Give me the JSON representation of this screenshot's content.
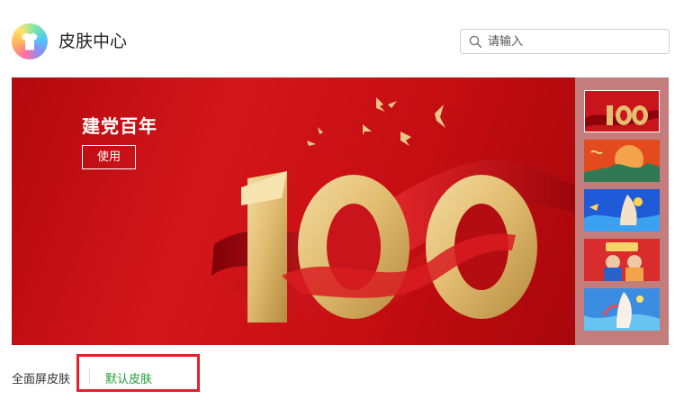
{
  "header": {
    "title": "皮肤中心",
    "search_placeholder": "请输入"
  },
  "featured": {
    "title": "建党百年",
    "use_label": "使用",
    "artwork_number": "100"
  },
  "thumbnails": [
    {
      "name": "100",
      "selected": true
    },
    {
      "name": "theme-2",
      "selected": false
    },
    {
      "name": "theme-3",
      "selected": false
    },
    {
      "name": "theme-4",
      "selected": false
    },
    {
      "name": "theme-5",
      "selected": false
    }
  ],
  "tabs": {
    "fullscreen": "全面屏皮肤",
    "default": "默认皮肤"
  },
  "colors": {
    "accent_green": "#21a038",
    "banner_red": "#d3161b",
    "highlight_red": "#e5202b"
  }
}
